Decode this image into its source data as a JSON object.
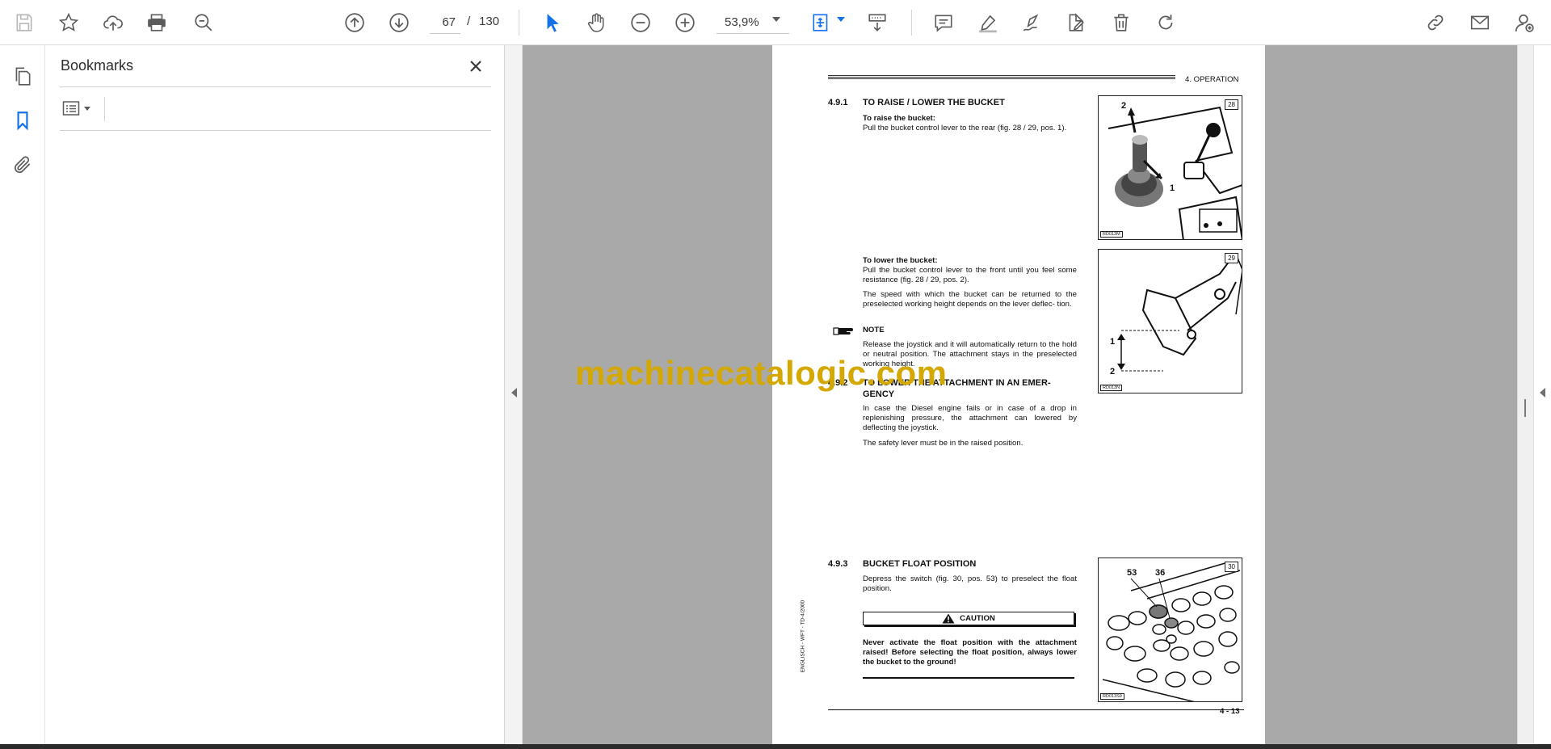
{
  "toolbar": {
    "page_current": "67",
    "page_separator": "/",
    "page_total": "130",
    "zoom": "53,9%"
  },
  "sidebar": {
    "title": "Bookmarks"
  },
  "document": {
    "header_section": "4. OPERATION",
    "s491_num": "4.9.1",
    "s491_title": "TO RAISE / LOWER THE BUCKET",
    "raise_heading": "To raise the bucket:",
    "raise_text": "Pull the bucket control lever to the rear (fig. 28 / 29, pos. 1).",
    "lower_heading": "To lower the bucket:",
    "lower_text": "Pull the bucket control lever to the front until you feel some resistance (fig. 28 / 29, pos. 2).",
    "speed_text": "The speed with which the bucket can be returned to the preselected working height depends on the lever deflec- tion.",
    "note_label": "NOTE",
    "note_text": "Release the joystick and it will automatically return to the hold or neutral position. The attachment stays in the preselected working height.",
    "s492_num": "4.9.2",
    "s492_title": "TO LOWER THE ATTACHMENT IN AN EMER- GENCY",
    "emergency_text": "In case the Diesel engine fails or in case of a drop in replenishing pressure, the attachment can lowered by deflecting the joystick.",
    "safety_text": "The safety lever must be in the raised position.",
    "s493_num": "4.9.3",
    "s493_title": "BUCKET FLOAT POSITION",
    "float_text": "Depress the switch (fig. 30, pos. 53) to preselect the float position.",
    "caution_label": "CAUTION",
    "caution_text": "Never activate the float position with the attachment raised! Before selecting the float position, always lower the bucket to the ground!",
    "side_text": "ENGLISCH - WFT - TD-4/2000",
    "page_footer": "4 - 13",
    "fig28": {
      "num": "28",
      "code": "RD013M",
      "label_1": "1",
      "label_2": "2"
    },
    "fig29": {
      "num": "29",
      "code": "RD013N",
      "label_1": "1",
      "label_2": "2"
    },
    "fig30": {
      "num": "30",
      "code": "RD013S9",
      "label_53": "53",
      "label_36": "36"
    }
  },
  "watermark": "machinecatalogic.com"
}
